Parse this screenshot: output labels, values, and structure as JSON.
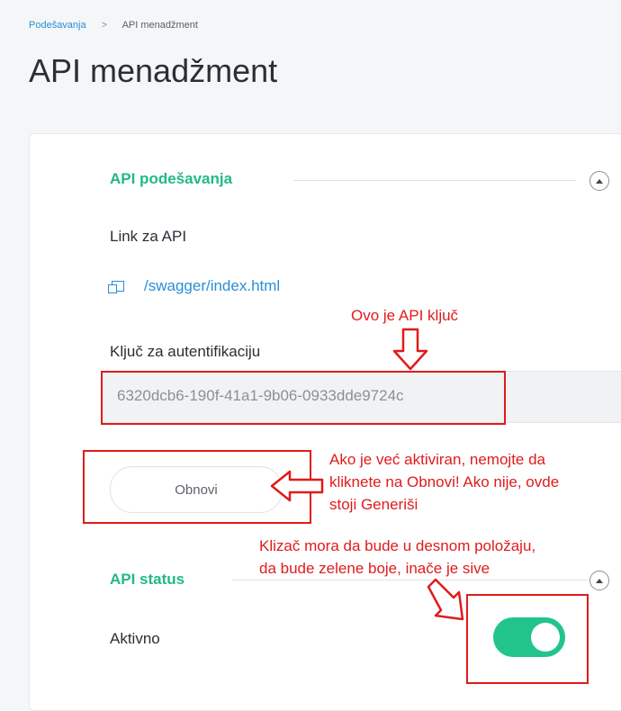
{
  "breadcrumb": {
    "parent": "Podešavanja",
    "separator": ">",
    "current": "API menadžment"
  },
  "page_title": "API menadžment",
  "api_settings": {
    "title": "API podešavanja",
    "link_label": "Link za API",
    "link_text": "/swagger/index.html",
    "key_label": "Ključ za autentifikaciju",
    "key_value": "6320dcb6-190f-41a1-9b06-0933dde9724c",
    "regenerate_button": "Obnovi"
  },
  "api_status": {
    "title": "API status",
    "active_label": "Aktivno",
    "toggle_on": true
  },
  "annotations": {
    "key_note": "Ovo je API ključ",
    "button_note_lines": [
      "Ako je već aktiviran, nemojte da",
      "kliknete na Obnovi! Ako nije, ovde",
      "stoji Generiši"
    ],
    "toggle_note_lines": [
      "Klizač mora da bude u desnom položaju,",
      "da bude zelene boje, inače je sive"
    ]
  },
  "colors": {
    "accent_green": "#22b986",
    "toggle_green": "#22c48b",
    "link_blue": "#2a8ed6",
    "annotation_red": "#e01b1b"
  },
  "icons": [
    "copy-link-icon",
    "collapse-up-icon"
  ]
}
